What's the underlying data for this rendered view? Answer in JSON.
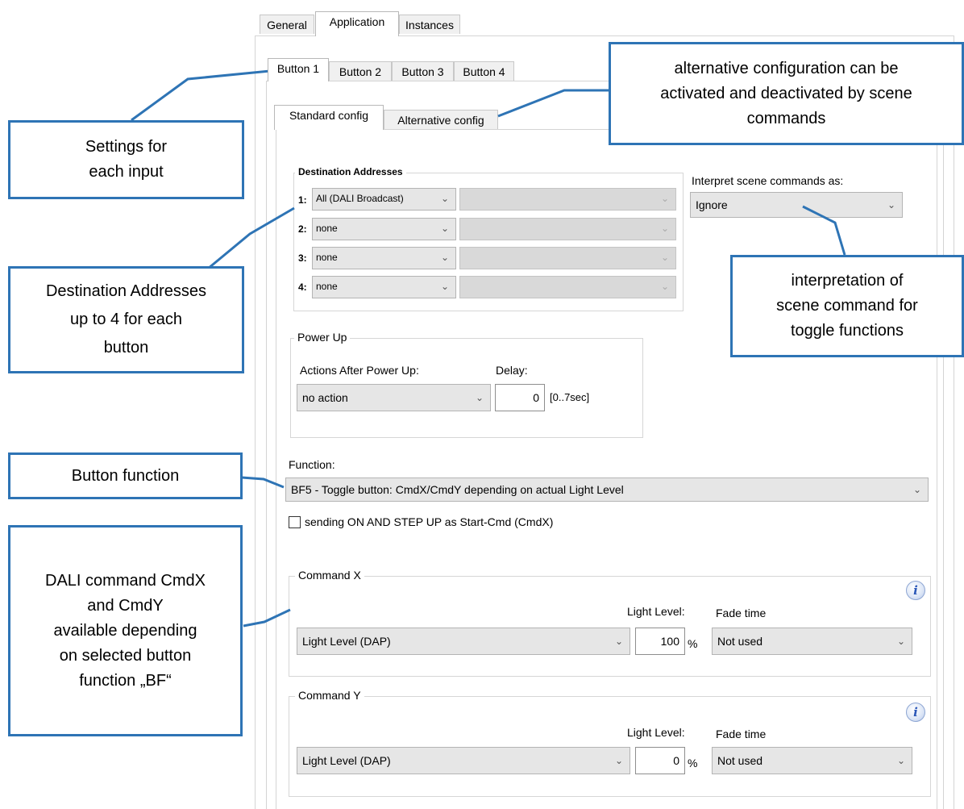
{
  "top_tabs": [
    "General",
    "Application",
    "Instances"
  ],
  "button_tabs": [
    "Button 1",
    "Button 2",
    "Button 3",
    "Button 4"
  ],
  "config_tabs": [
    "Standard config",
    "Alternative config"
  ],
  "destination": {
    "title": "Destination Addresses",
    "rows": [
      {
        "num": "1:",
        "value": "All (DALI Broadcast)"
      },
      {
        "num": "2:",
        "value": "none"
      },
      {
        "num": "3:",
        "value": "none"
      },
      {
        "num": "4:",
        "value": "none"
      }
    ]
  },
  "scene": {
    "label": "Interpret scene commands as:",
    "value": "Ignore"
  },
  "power_up": {
    "title": "Power Up",
    "actions_label": "Actions After Power Up:",
    "delay_label": "Delay:",
    "action_value": "no action",
    "delay_value": "0",
    "delay_range": "[0..7sec]"
  },
  "function": {
    "label": "Function:",
    "value": "BF5 - Toggle button:  CmdX/CmdY depending on actual Light Level",
    "checkbox_label": "sending ON AND STEP UP as Start-Cmd (CmdX)"
  },
  "command_x": {
    "title": "Command X",
    "light_level_label": "Light Level:",
    "fade_label": "Fade time",
    "command_value": "Light Level (DAP)",
    "level_value": "100",
    "unit": "%",
    "fade_value": "Not used"
  },
  "command_y": {
    "title": "Command Y",
    "light_level_label": "Light Level:",
    "fade_label": "Fade time",
    "command_value": "Light Level (DAP)",
    "level_value": "0",
    "unit": "%",
    "fade_value": "Not used"
  },
  "callouts": {
    "settings": [
      "Settings for",
      "each input"
    ],
    "destination": [
      "Destination Addresses",
      "up to 4 for each",
      "button"
    ],
    "button_function": [
      "Button function"
    ],
    "dali": [
      "DALI command CmdX",
      "and CmdY",
      "available depending",
      "on selected button",
      "function „BF“"
    ],
    "alternative": [
      "alternative configuration can be",
      "activated and deactivated by scene",
      "commands"
    ],
    "interpretation": [
      "interpretation of",
      "scene command for",
      "toggle functions"
    ]
  },
  "icons": {
    "chevron": "chevron-down-icon",
    "info": "info-icon",
    "checkbox": "checkbox-icon"
  },
  "colors": {
    "callout_border": "#2e74b5"
  }
}
